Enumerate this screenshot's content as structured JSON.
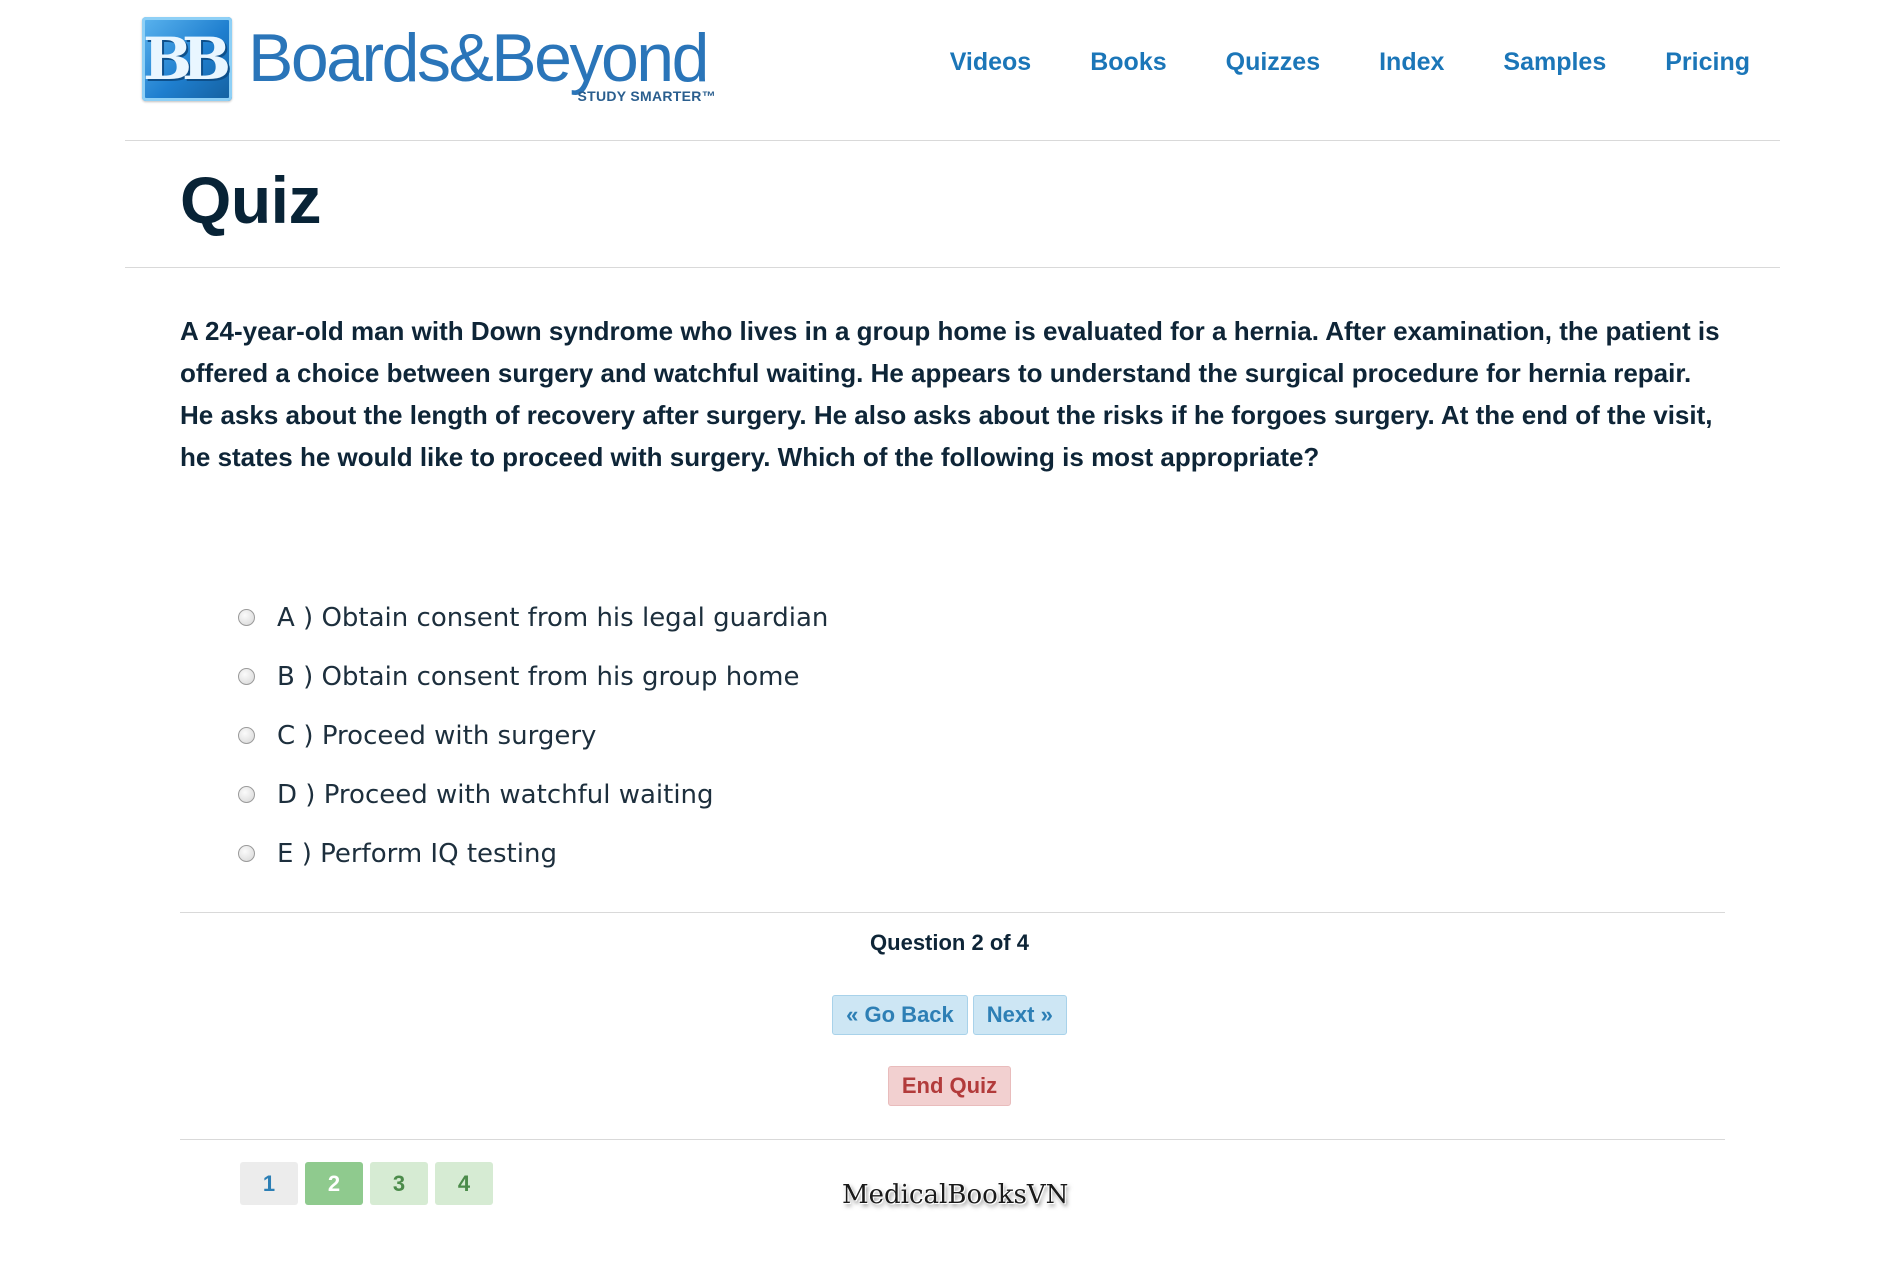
{
  "header": {
    "logo": {
      "mark": "BB",
      "wordmark": "Boards&Beyond",
      "tagline": "STUDY SMARTER™"
    },
    "nav": [
      "Videos",
      "Books",
      "Quizzes",
      "Index",
      "Samples",
      "Pricing"
    ]
  },
  "page_title": "Quiz",
  "question": {
    "text": "A 24-year-old man with Down syndrome who lives in a group home is evaluated for a hernia. After examination, the patient is offered a choice between surgery and watchful waiting. He appears to understand the surgical procedure for hernia repair. He asks about the length of recovery after surgery. He also asks about the risks if he forgoes surgery. At the end of the visit, he states he would like to proceed with surgery. Which of the following is most appropriate?",
    "answers": [
      "A ) Obtain consent from his legal guardian",
      "B ) Obtain consent from his group home",
      "C ) Proceed with surgery",
      "D ) Proceed with watchful waiting",
      "E ) Perform IQ testing"
    ]
  },
  "progress": {
    "label": "Question 2 of 4",
    "current": 2,
    "total": 4
  },
  "buttons": {
    "back": "« Go Back",
    "next": "Next »",
    "end": "End Quiz"
  },
  "pagination": [
    "1",
    "2",
    "3",
    "4"
  ],
  "watermark": "MedicalBooksVN",
  "colors": {
    "nav_link": "#1b76b8",
    "title": "#082336",
    "current_page": "#8fca8e",
    "end_quiz": "#b23b3b"
  }
}
